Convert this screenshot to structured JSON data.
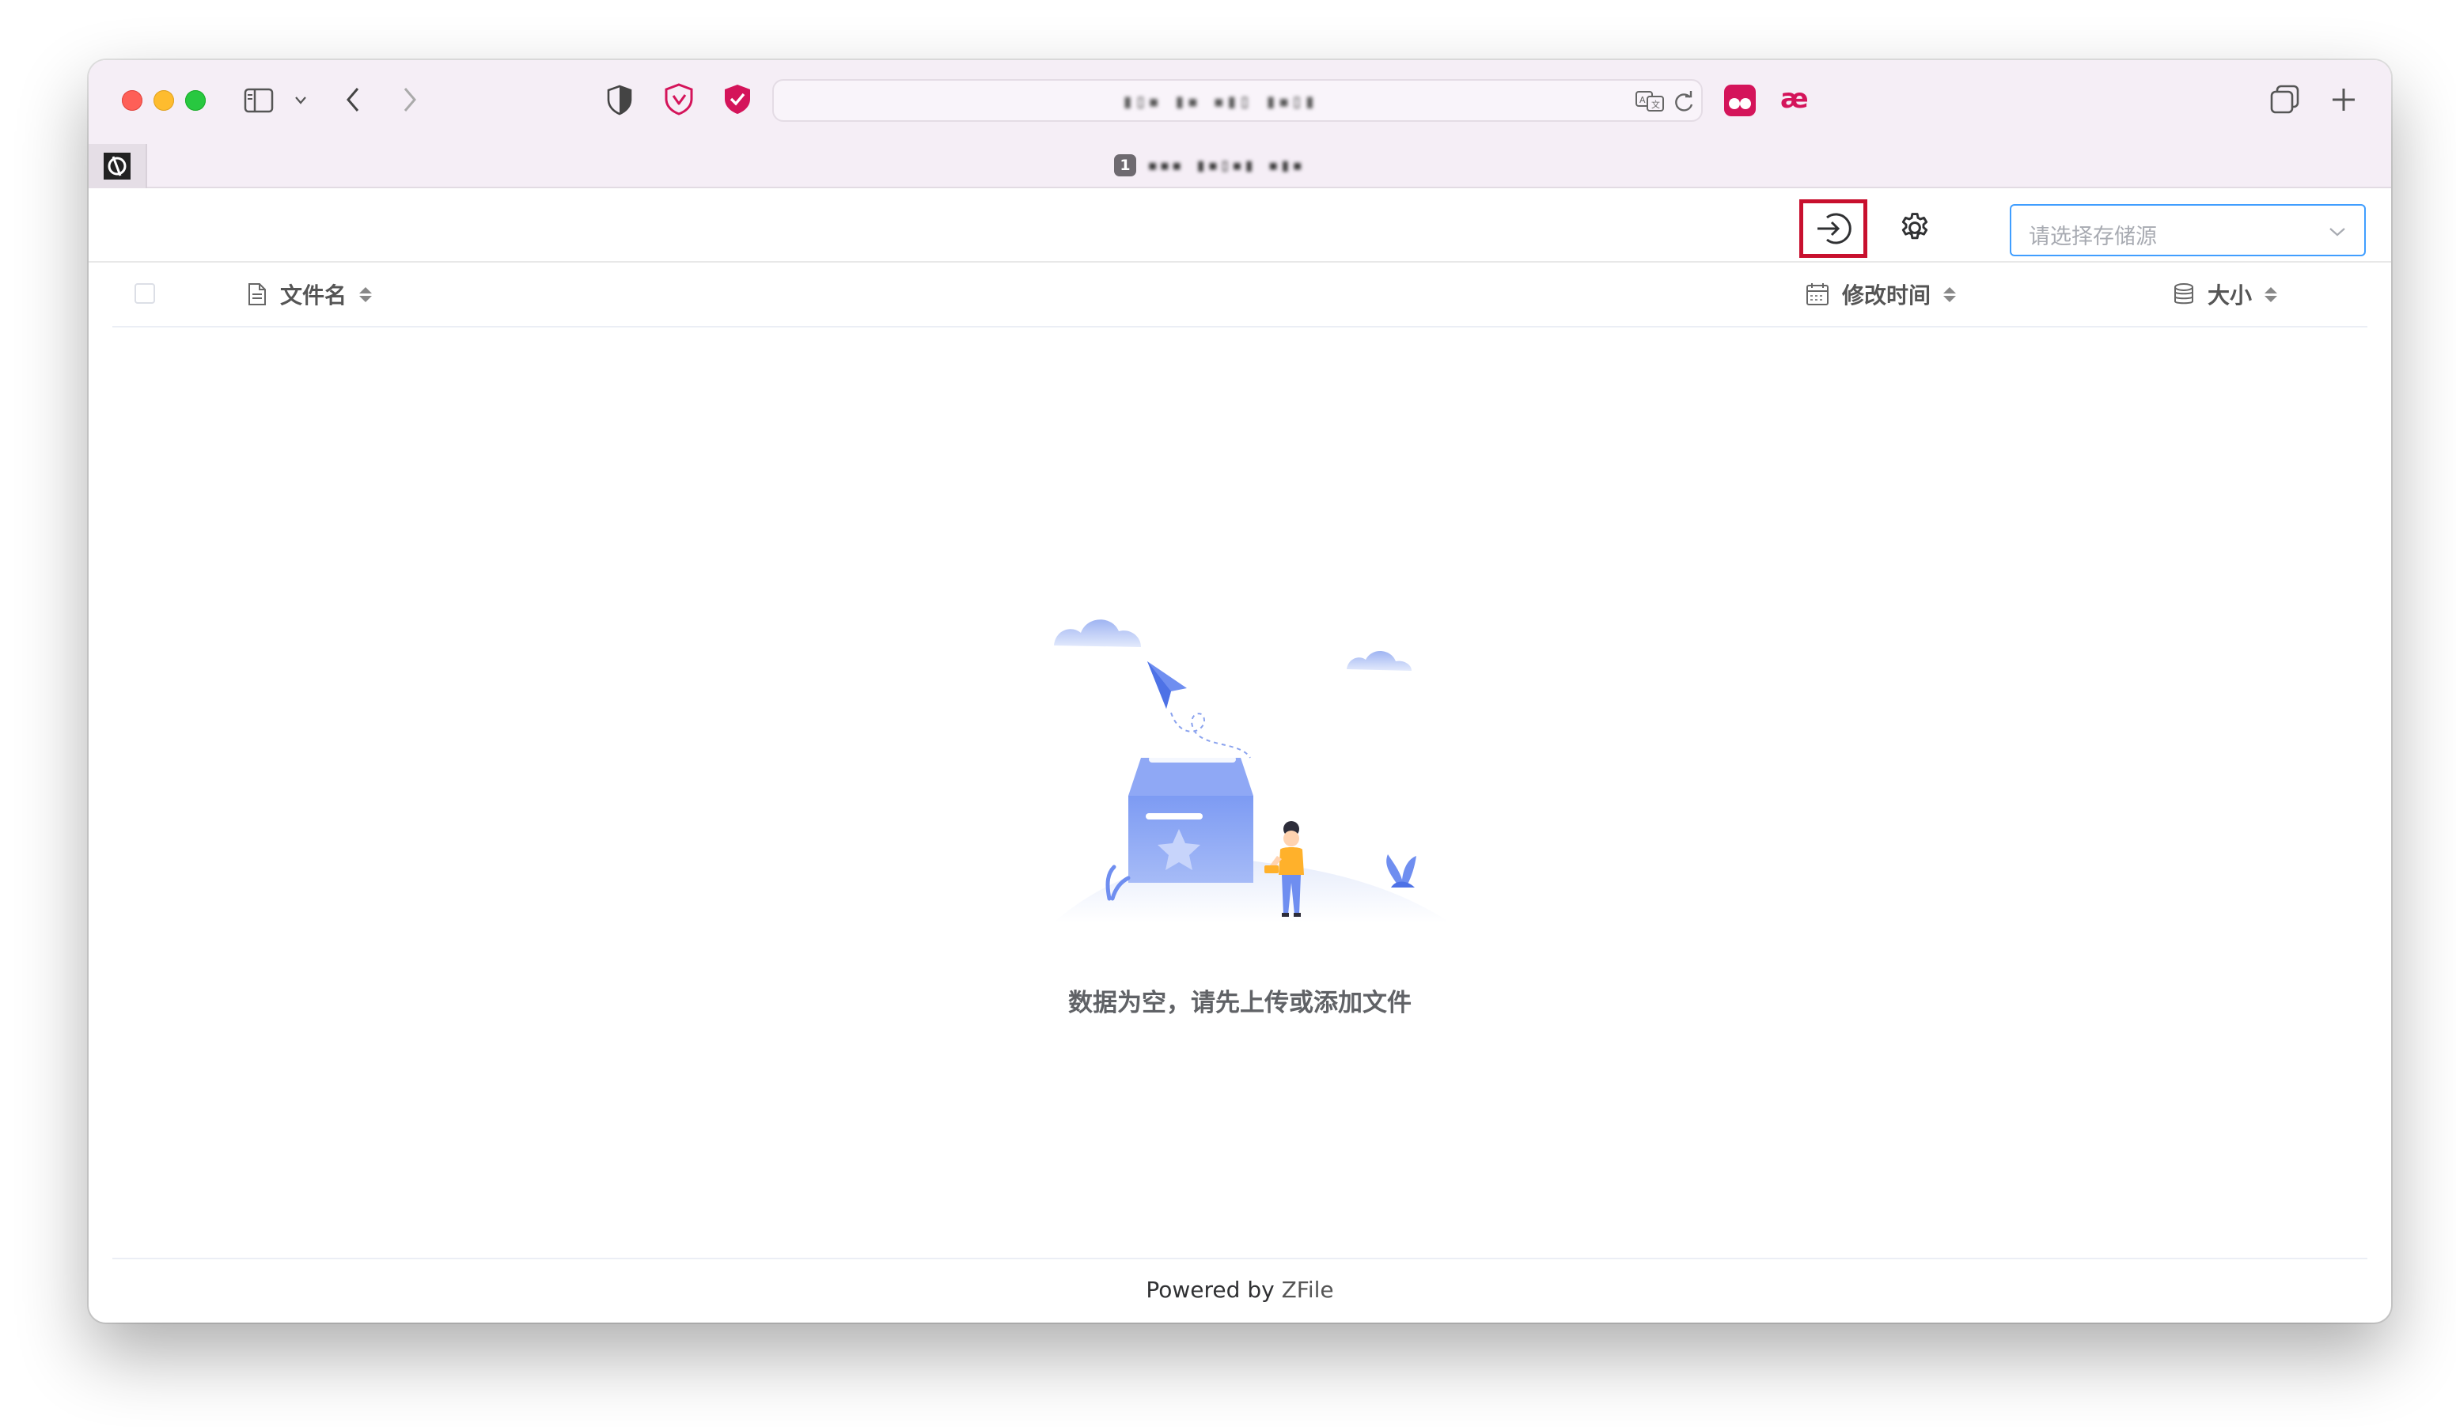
{
  "browser": {
    "address_text": "▮▯▪ ▮▪ ▪▮▯ ▮▪▯▮",
    "tab_index": "1",
    "tab_title": "▪▪▪ ▮▪▯▪▮ ▪▮▪"
  },
  "toolbar": {
    "login_icon": "login-icon",
    "settings_icon": "gear-icon",
    "storage_placeholder": "请选择存储源"
  },
  "table": {
    "columns": [
      {
        "label": "文件名",
        "icon": "file-icon"
      },
      {
        "label": "修改时间",
        "icon": "calendar-icon"
      },
      {
        "label": "大小",
        "icon": "database-icon"
      }
    ]
  },
  "empty": {
    "message": "数据为空，请先上传或添加文件"
  },
  "footer": {
    "powered_by": "Powered by",
    "brand": "ZFile"
  },
  "colors": {
    "accent": "#409eff",
    "highlight": "#c8102e",
    "chrome": "#f5eef6",
    "illustration": "#6f8ef0"
  }
}
